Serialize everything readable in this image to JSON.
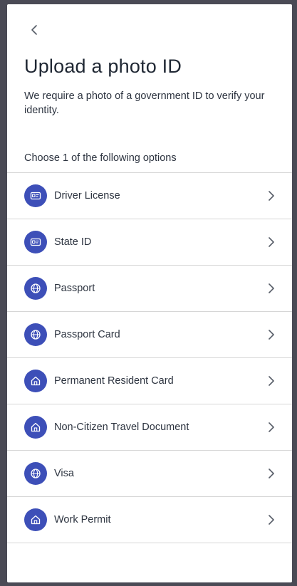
{
  "header": {
    "back_icon": "chevron-left-icon",
    "title": "Upload a photo ID",
    "subtitle": "We require a photo of a government ID to verify your identity."
  },
  "options": {
    "label": "Choose 1 of the following options",
    "items": [
      {
        "label": "Driver License",
        "icon": "id-card-icon"
      },
      {
        "label": "State ID",
        "icon": "id-card-icon"
      },
      {
        "label": "Passport",
        "icon": "globe-icon"
      },
      {
        "label": "Passport Card",
        "icon": "globe-icon"
      },
      {
        "label": "Permanent Resident Card",
        "icon": "home-icon"
      },
      {
        "label": "Non-Citizen Travel Document",
        "icon": "home-icon"
      },
      {
        "label": "Visa",
        "icon": "globe-icon"
      },
      {
        "label": "Work Permit",
        "icon": "home-icon"
      }
    ],
    "chevron_icon": "chevron-right-icon"
  },
  "colors": {
    "accent": "#3d4fb8",
    "text": "#2d3440",
    "divider": "#d6d6d6",
    "backdrop": "#4a4a55"
  }
}
